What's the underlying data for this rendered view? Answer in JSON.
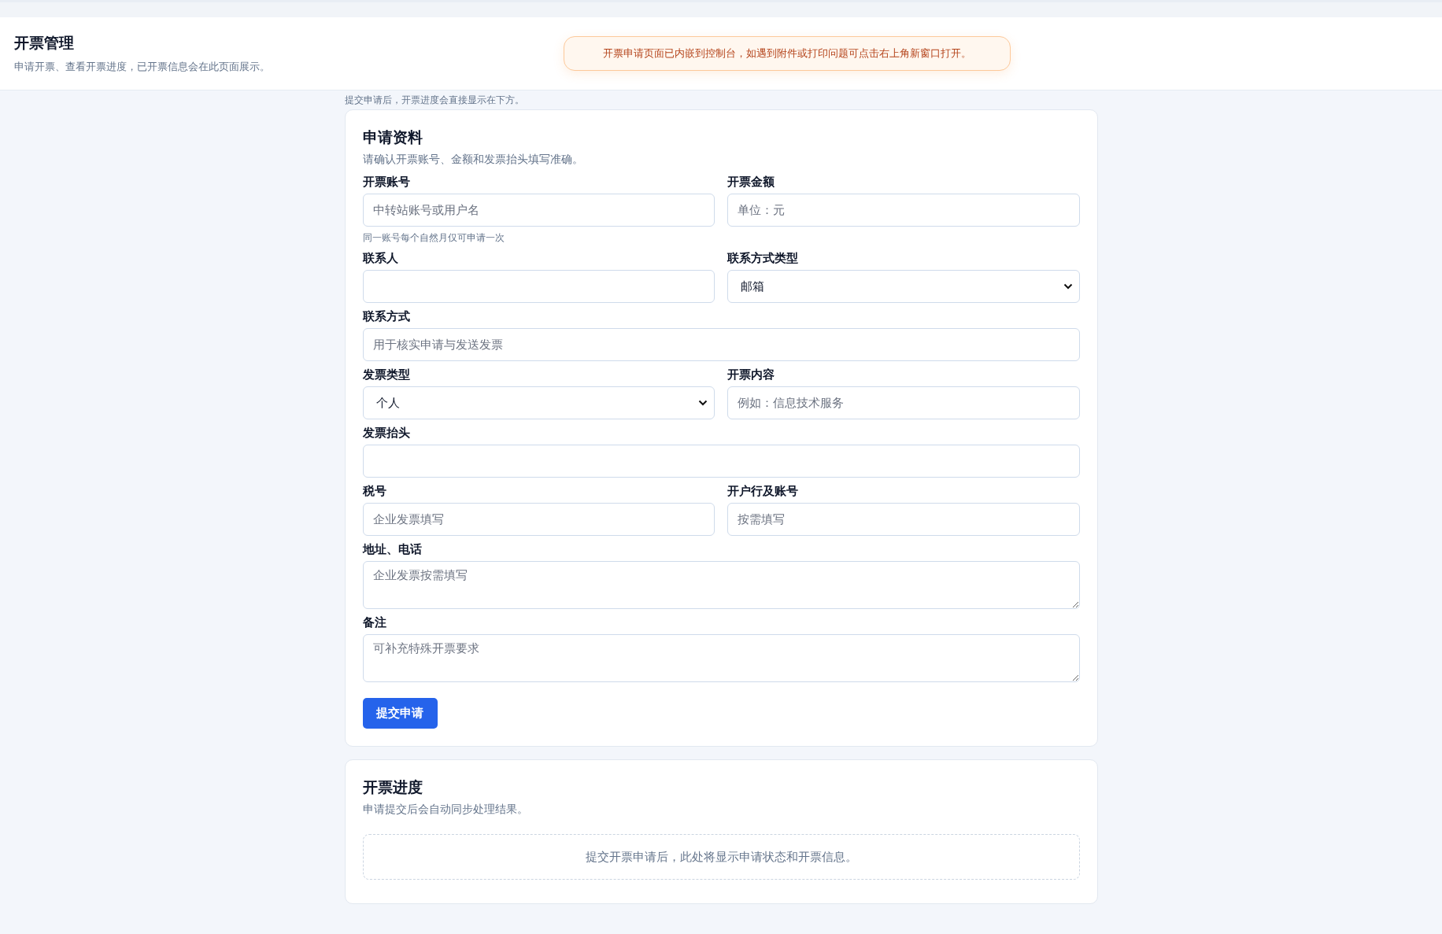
{
  "header": {
    "title": "开票管理",
    "subtitle": "申请开票、查看开票进度，已开票信息会在此页面展示。"
  },
  "notice": "开票申请页面已内嵌到控制台，如遇到附件或打印问题可点击右上角新窗口打开。",
  "intro": "提交申请后，开票进度会直接显示在下方。",
  "application": {
    "title": "申请资料",
    "subtitle": "请确认开票账号、金额和发票抬头填写准确。",
    "rows": [
      [
        {
          "label": "开票账号",
          "kind": "text",
          "placeholder": "中转站账号或用户名",
          "hint": "同一账号每个自然月仅可申请一次"
        },
        {
          "label": "开票金额",
          "kind": "text",
          "placeholder": "单位：元"
        }
      ],
      [
        {
          "label": "联系人",
          "kind": "text"
        },
        {
          "label": "联系方式类型",
          "kind": "select",
          "value": "邮箱"
        }
      ],
      [
        {
          "label": "联系方式",
          "kind": "text",
          "placeholder": "用于核实申请与发送发票"
        }
      ],
      [
        {
          "label": "发票类型",
          "kind": "select",
          "value": "个人"
        },
        {
          "label": "开票内容",
          "kind": "text",
          "placeholder": "例如：信息技术服务"
        }
      ],
      [
        {
          "label": "发票抬头",
          "kind": "text"
        }
      ],
      [
        {
          "label": "税号",
          "kind": "text",
          "placeholder": "企业发票填写"
        },
        {
          "label": "开户行及账号",
          "kind": "text",
          "placeholder": "按需填写"
        }
      ],
      [
        {
          "label": "地址、电话",
          "kind": "textarea",
          "placeholder": "企业发票按需填写"
        }
      ],
      [
        {
          "label": "备注",
          "kind": "textarea",
          "placeholder": "可补充特殊开票要求"
        }
      ]
    ],
    "submit": "提交申请"
  },
  "progress": {
    "title": "开票进度",
    "subtitle": "申请提交后会自动同步处理结果。",
    "empty": "提交开票申请后，此处将显示申请状态和开票信息。"
  }
}
